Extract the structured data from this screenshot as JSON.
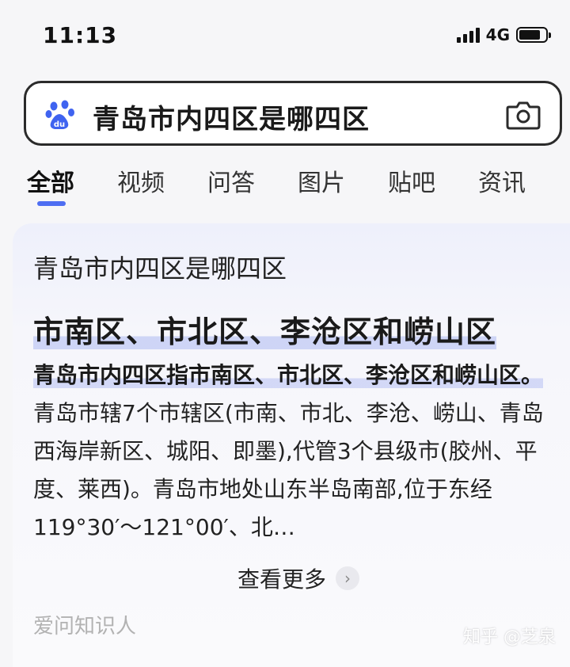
{
  "status_bar": {
    "time": "11:13",
    "network": "4G",
    "battery_level": 0.8
  },
  "search": {
    "query": "青岛市内四区是哪四区",
    "left_icon": "baidu-paw-icon",
    "right_icon": "camera-icon"
  },
  "tabs": [
    {
      "label": "全部",
      "active": true
    },
    {
      "label": "视频"
    },
    {
      "label": "问答"
    },
    {
      "label": "图片"
    },
    {
      "label": "贴吧"
    },
    {
      "label": "资讯"
    }
  ],
  "result": {
    "title": "青岛市内四区是哪四区",
    "answer": "市南区、市北区、李沧区和崂山区",
    "lead": "青岛市内四区指市南区、市北区、李沧区和崂山区。",
    "body": "青岛市辖7个市辖区(市南、市北、李沧、崂山、青岛西海岸新区、城阳、即墨),代管3个县级市(胶州、平度、莱西)。青岛市地处山东半岛南部,位于东经119°30′～121°00′、北…",
    "more_label": "查看更多",
    "source": "爱问知识人"
  },
  "watermark": "知乎 @芝泉",
  "colors": {
    "accent": "#4e6ef2",
    "highlight": "#9eacf0"
  }
}
